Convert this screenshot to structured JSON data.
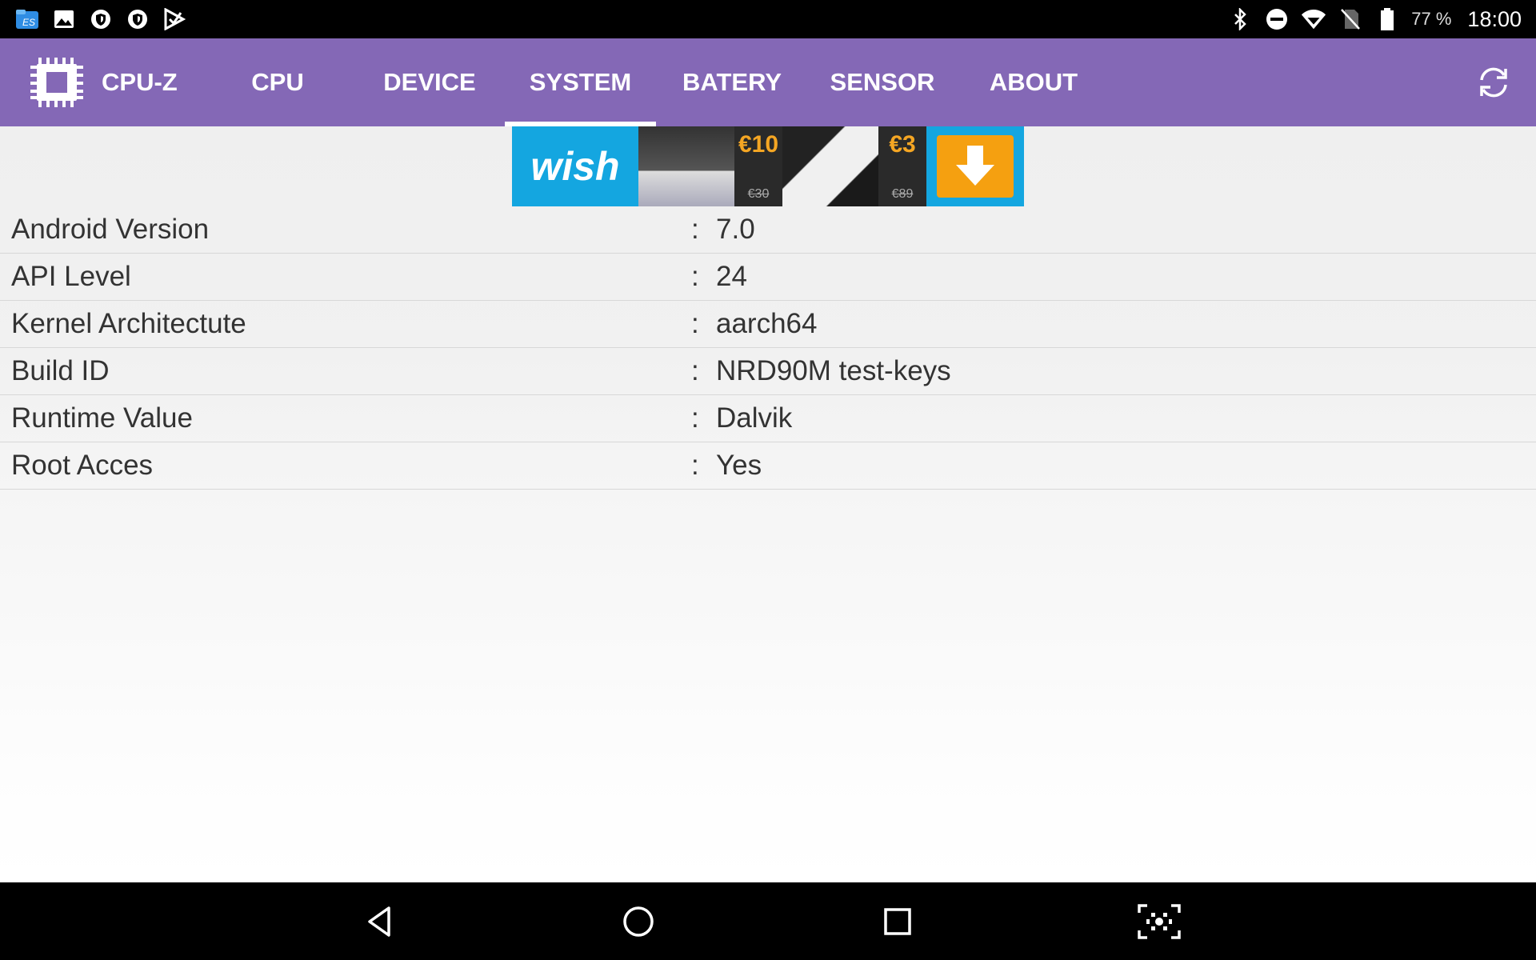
{
  "status_bar": {
    "battery_percent": "77 %",
    "time": "18:00",
    "left_icons": [
      "es-file-explorer-icon",
      "gallery-icon",
      "shield-icon",
      "shield-icon",
      "play-store-icon"
    ],
    "right_icons": [
      "bluetooth-icon",
      "do-not-disturb-icon",
      "wifi-icon",
      "no-sim-icon",
      "battery-icon"
    ]
  },
  "app_bar": {
    "title": "CPU-Z",
    "tabs": [
      {
        "label": "CPU"
      },
      {
        "label": "DEVICE"
      },
      {
        "label": "SYSTEM"
      },
      {
        "label": "BATERY"
      },
      {
        "label": "SENSOR"
      },
      {
        "label": "ABOUT"
      }
    ],
    "active_tab": "SYSTEM"
  },
  "ad": {
    "brand": "wish",
    "price1_new": "€10",
    "price1_old": "€30",
    "price2_new": "€3",
    "price2_old": "€89"
  },
  "system_info": [
    {
      "label": "Android Version",
      "value": "7.0"
    },
    {
      "label": "API Level",
      "value": "24"
    },
    {
      "label": "Kernel Architectute",
      "value": "aarch64"
    },
    {
      "label": "Build ID",
      "value": "NRD90M test-keys"
    },
    {
      "label": "Runtime Value",
      "value": "Dalvik"
    },
    {
      "label": "Root Acces",
      "value": "Yes"
    }
  ],
  "colors": {
    "accent": "#8468b6",
    "status_bar": "#000000",
    "nav_bar": "#000000"
  }
}
